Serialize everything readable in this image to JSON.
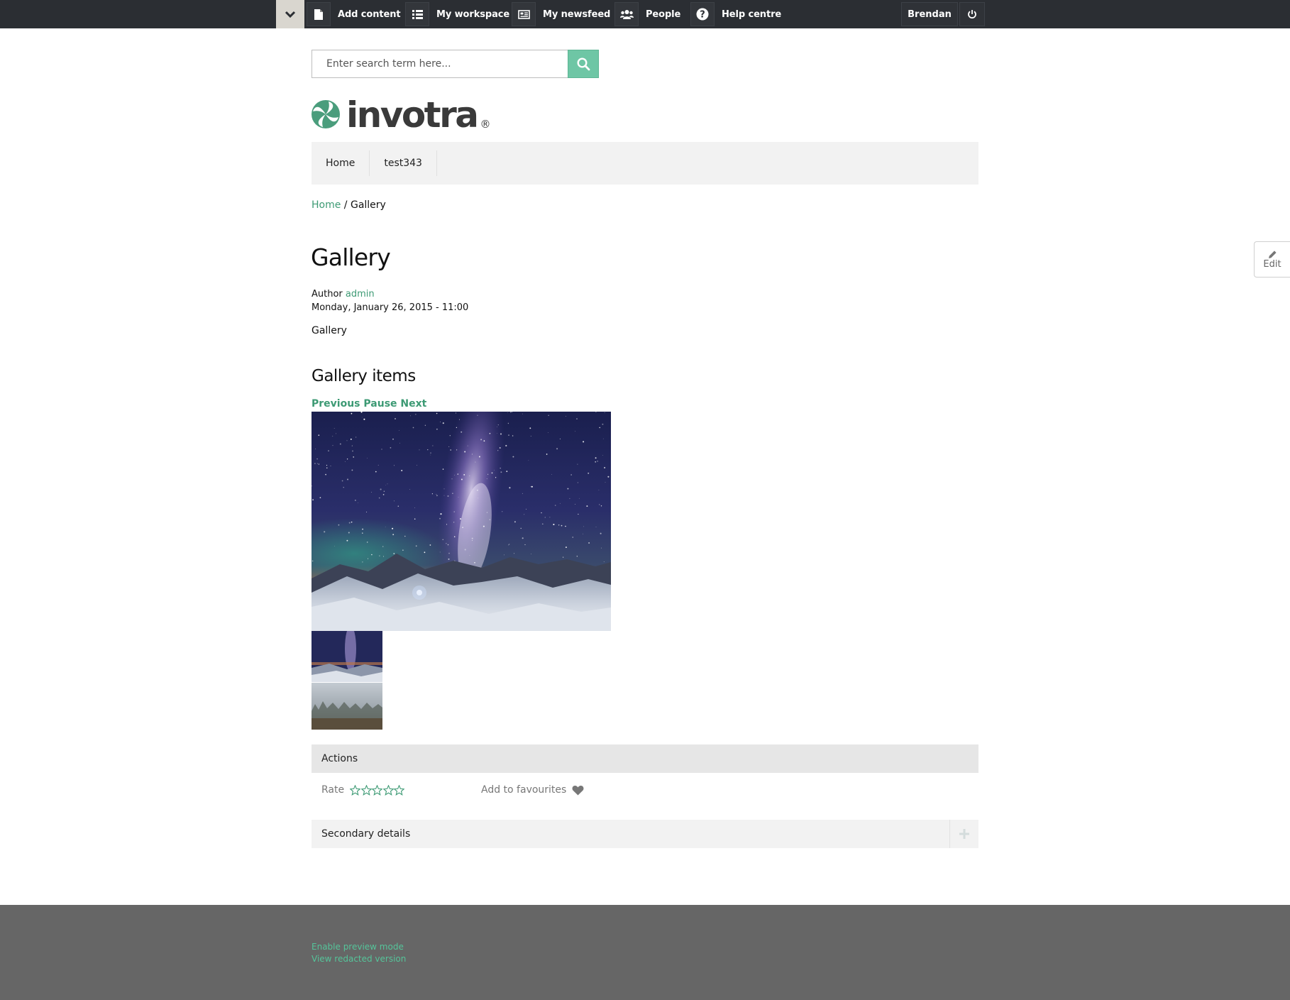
{
  "toolbar": {
    "items": [
      {
        "label": "Add content",
        "icon": "file-icon"
      },
      {
        "label": "My workspace",
        "icon": "list-icon"
      },
      {
        "label": "My newsfeed",
        "icon": "newspaper-icon"
      },
      {
        "label": "People",
        "icon": "users-icon"
      },
      {
        "label": "Help centre",
        "icon": "question-icon"
      }
    ],
    "user": "Brendan"
  },
  "search": {
    "placeholder": "Enter search term here..."
  },
  "logo": {
    "text": "invotra",
    "registered": "®"
  },
  "nav": {
    "items": [
      "Home",
      "test343"
    ]
  },
  "breadcrumb": {
    "home": "Home",
    "separator": "/",
    "current": "Gallery"
  },
  "page": {
    "title": "Gallery",
    "author_label": "Author",
    "author": "admin",
    "date": "Monday, January 26, 2015 - 11:00",
    "body": "Gallery"
  },
  "gallery": {
    "title": "Gallery items",
    "controls": {
      "previous": "Previous",
      "pause": "Pause",
      "next": "Next"
    }
  },
  "actions": {
    "header": "Actions",
    "rate_label": "Rate",
    "rating": 0,
    "rating_max": 5,
    "favourite_label": "Add to favourites"
  },
  "secondary": {
    "label": "Secondary details"
  },
  "edit": {
    "label": "Edit"
  },
  "footer": {
    "links": [
      "Enable preview mode",
      "View redacted version"
    ]
  },
  "colors": {
    "accent": "#3d9a74",
    "search_button": "#6ec6a5",
    "toolbar": "#2b2e33",
    "footer": "#666666"
  }
}
